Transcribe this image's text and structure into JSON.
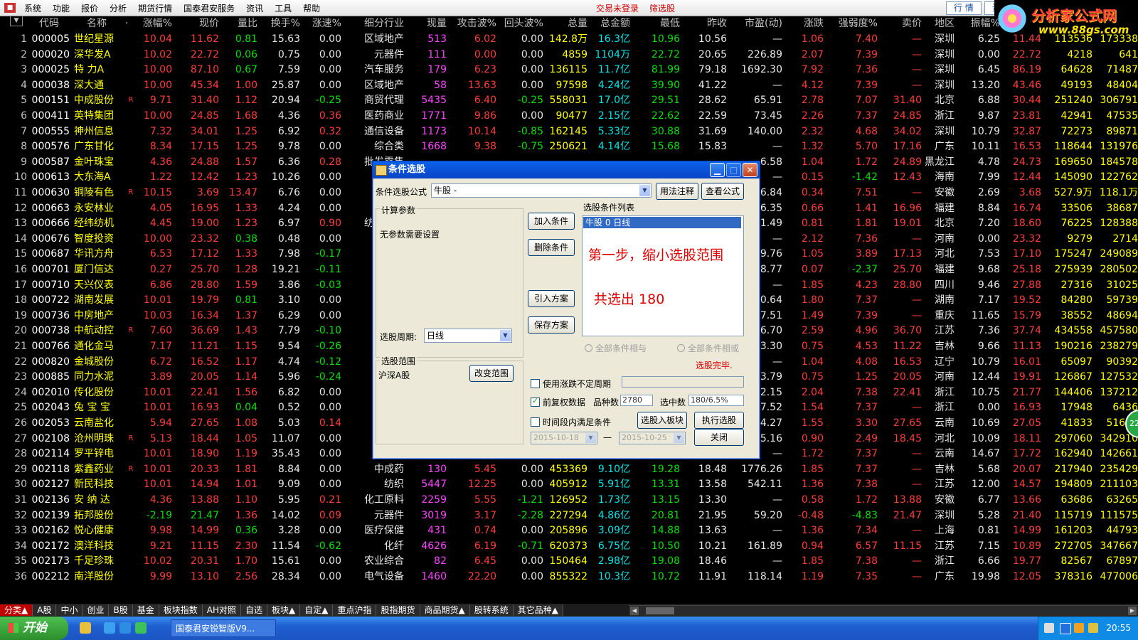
{
  "menu": {
    "items": [
      "系统",
      "功能",
      "报价",
      "分析",
      "期货行情",
      "国泰君安服务",
      "资讯",
      "工具",
      "帮助"
    ],
    "red_items": [
      "交易未登录",
      "筛选股"
    ],
    "right_buttons": [
      "行 情",
      "资"
    ]
  },
  "brand": {
    "title": "分析家公式网",
    "url": "www.88gs.com"
  },
  "header": [
    "代码",
    "名称",
    "·",
    "涨幅%",
    "现价",
    "量比",
    "换手%",
    "涨速%",
    "细分行业",
    "现量",
    "攻击波%",
    "回头波%",
    "总量",
    "总金额",
    "最低",
    "昨收",
    "市盈(动)",
    "涨跌",
    "强弱度%",
    "卖价",
    "地区",
    "振幅%",
    "最高",
    "总量",
    "现价"
  ],
  "rows": [
    [
      "1",
      "000005",
      "世纪星源",
      "",
      "10.04",
      "11.62",
      "0.81",
      "15.63",
      "0.00",
      "区域地产",
      "513",
      "6.02",
      "0.00",
      "142.8万",
      "16.3亿",
      "10.96",
      "10.56",
      "—",
      "1.06",
      "7.40",
      "—",
      "深圳",
      "6.25",
      "11.44",
      "113536",
      "173338"
    ],
    [
      "2",
      "000020",
      "深华发A",
      "",
      "10.02",
      "22.72",
      "0.06",
      "0.75",
      "0.00",
      "元器件",
      "111",
      "0.00",
      "0.00",
      "4859",
      "1104万",
      "22.72",
      "20.65",
      "226.89",
      "2.07",
      "7.39",
      "—",
      "深圳",
      "0.00",
      "22.72",
      "4218",
      "641"
    ],
    [
      "3",
      "000025",
      "特 力A",
      "",
      "10.00",
      "87.10",
      "0.67",
      "7.59",
      "0.00",
      "汽车服务",
      "179",
      "6.23",
      "0.00",
      "136115",
      "11.7亿",
      "81.99",
      "79.18",
      "1692.30",
      "7.92",
      "7.36",
      "—",
      "深圳",
      "6.45",
      "86.19",
      "64628",
      "71487"
    ],
    [
      "4",
      "000038",
      "深大通",
      "",
      "10.00",
      "45.34",
      "1.00",
      "25.87",
      "0.00",
      "区域地产",
      "58",
      "13.63",
      "0.00",
      "97598",
      "4.24亿",
      "39.90",
      "41.22",
      "—",
      "4.12",
      "7.39",
      "—",
      "深圳",
      "13.20",
      "43.46",
      "49193",
      "48404"
    ],
    [
      "5",
      "000151",
      "中成股份",
      "R",
      "9.71",
      "31.40",
      "1.12",
      "20.94",
      "-0.25",
      "商贸代理",
      "5435",
      "6.40",
      "-0.25",
      "558031",
      "17.0亿",
      "29.51",
      "28.62",
      "65.91",
      "2.78",
      "7.07",
      "31.40",
      "北京",
      "6.88",
      "30.44",
      "251240",
      "306791"
    ],
    [
      "6",
      "000411",
      "英特集团",
      "",
      "10.00",
      "24.85",
      "1.68",
      "4.36",
      "0.36",
      "医药商业",
      "1771",
      "9.86",
      "0.00",
      "90477",
      "2.15亿",
      "22.62",
      "22.59",
      "73.45",
      "2.26",
      "7.37",
      "24.85",
      "浙江",
      "9.87",
      "23.81",
      "42941",
      "47535"
    ],
    [
      "7",
      "000555",
      "神州信息",
      "",
      "7.32",
      "34.01",
      "1.25",
      "6.92",
      "0.32",
      "通信设备",
      "1173",
      "10.14",
      "-0.85",
      "162145",
      "5.33亿",
      "30.88",
      "31.69",
      "140.00",
      "2.32",
      "4.68",
      "34.02",
      "深圳",
      "10.79",
      "32.87",
      "72273",
      "89871"
    ],
    [
      "8",
      "000576",
      "广东甘化",
      "",
      "8.34",
      "17.15",
      "1.25",
      "9.78",
      "0.00",
      "综合类",
      "1668",
      "9.38",
      "-0.75",
      "250621",
      "4.14亿",
      "15.68",
      "15.83",
      "—",
      "1.32",
      "5.70",
      "17.16",
      "广东",
      "10.11",
      "16.53",
      "118644",
      "131976"
    ],
    [
      "9",
      "000587",
      "金叶珠宝",
      "",
      "4.36",
      "24.88",
      "1.57",
      "6.36",
      "0.28",
      "批发零售",
      "",
      "",
      "",
      "",
      "",
      "",
      "",
      "6.58",
      "1.04",
      "1.72",
      "24.89",
      "黑龙江",
      "4.78",
      "24.73",
      "169650",
      "184578"
    ],
    [
      "10",
      "000613",
      "大东海A",
      "",
      "1.22",
      "12.42",
      "1.23",
      "10.26",
      "0.00",
      "旅游",
      "",
      "",
      "",
      "",
      "",
      "",
      "",
      "—",
      "0.15",
      "-1.42",
      "12.43",
      "海南",
      "7.99",
      "12.44",
      "145090",
      "122762"
    ],
    [
      "11",
      "000630",
      "铜陵有色",
      "R",
      "10.15",
      "3.69",
      "13.47",
      "6.76",
      "0.00",
      "",
      "",
      "",
      "",
      "",
      "",
      "",
      "",
      "6.84",
      "0.34",
      "7.51",
      "—",
      "安徽",
      "2.69",
      "3.68",
      "527.9万",
      "118.1万"
    ],
    [
      "12",
      "000663",
      "永安林业",
      "",
      "4.05",
      "16.95",
      "1.33",
      "4.24",
      "0.00",
      "",
      "",
      "",
      "",
      "",
      "",
      "",
      "",
      "6.35",
      "0.66",
      "1.41",
      "16.96",
      "福建",
      "8.84",
      "16.74",
      "33506",
      "38687"
    ],
    [
      "13",
      "000666",
      "经纬纺机",
      "",
      "4.45",
      "19.00",
      "1.23",
      "6.97",
      "0.90",
      "纺织机械",
      "",
      "",
      "",
      "",
      "",
      "",
      "",
      "1.49",
      "0.81",
      "1.81",
      "19.01",
      "北京",
      "7.20",
      "18.60",
      "76225",
      "128388"
    ],
    [
      "14",
      "000676",
      "智度投资",
      "",
      "10.00",
      "23.32",
      "0.38",
      "0.48",
      "0.00",
      "",
      "",
      "",
      "",
      "",
      "",
      "",
      "",
      "—",
      "2.12",
      "7.36",
      "—",
      "河南",
      "0.00",
      "23.32",
      "9279",
      "2714"
    ],
    [
      "15",
      "000687",
      "华讯方舟",
      "",
      "6.53",
      "17.12",
      "1.33",
      "7.98",
      "-0.17",
      "",
      "",
      "",
      "",
      "",
      "",
      "",
      "",
      "9.76",
      "1.05",
      "3.89",
      "17.13",
      "河北",
      "7.53",
      "17.10",
      "175247",
      "249089"
    ],
    [
      "16",
      "000701",
      "厦门信达",
      "",
      "0.27",
      "25.70",
      "1.28",
      "19.21",
      "-0.11",
      "",
      "",
      "",
      "",
      "",
      "",
      "",
      "",
      "8.77",
      "0.07",
      "-2.37",
      "25.70",
      "福建",
      "9.68",
      "25.18",
      "275939",
      "280502"
    ],
    [
      "17",
      "000710",
      "天兴仪表",
      "",
      "6.86",
      "28.80",
      "1.59",
      "3.86",
      "-0.03",
      "汽车",
      "",
      "",
      "",
      "",
      "",
      "",
      "",
      "—",
      "1.85",
      "4.23",
      "28.80",
      "四川",
      "9.46",
      "27.88",
      "27316",
      "31025"
    ],
    [
      "18",
      "000722",
      "湖南发展",
      "",
      "10.01",
      "19.79",
      "0.81",
      "3.10",
      "0.00",
      "水力",
      "",
      "",
      "",
      "",
      "",
      "",
      "",
      "0.64",
      "1.80",
      "7.37",
      "—",
      "湖南",
      "7.17",
      "19.52",
      "84280",
      "59739"
    ],
    [
      "19",
      "000736",
      "中房地产",
      "",
      "10.03",
      "16.34",
      "1.37",
      "6.29",
      "0.00",
      "全国",
      "",
      "",
      "",
      "",
      "",
      "",
      "",
      "7.51",
      "1.49",
      "7.39",
      "—",
      "重庆",
      "11.65",
      "15.79",
      "38552",
      "48694"
    ],
    [
      "20",
      "000738",
      "中航动控",
      "R",
      "7.60",
      "36.69",
      "1.43",
      "7.79",
      "-0.10",
      "",
      "",
      "",
      "",
      "",
      "",
      "",
      "",
      "6.70",
      "2.59",
      "4.96",
      "36.70",
      "江苏",
      "7.36",
      "37.74",
      "434558",
      "457580"
    ],
    [
      "21",
      "000766",
      "通化金马",
      "",
      "7.17",
      "11.21",
      "1.15",
      "9.54",
      "-0.26",
      "",
      "",
      "",
      "",
      "",
      "",
      "",
      "",
      "3.30",
      "0.75",
      "4.53",
      "11.22",
      "吉林",
      "9.66",
      "11.13",
      "190216",
      "238279"
    ],
    [
      "22",
      "000820",
      "金城股份",
      "",
      "6.72",
      "16.52",
      "1.17",
      "4.74",
      "-0.12",
      "",
      "",
      "",
      "",
      "",
      "",
      "",
      "",
      "—",
      "1.04",
      "4.08",
      "16.53",
      "辽宁",
      "10.79",
      "16.01",
      "65097",
      "90392"
    ],
    [
      "23",
      "000885",
      "同力水泥",
      "",
      "3.89",
      "20.05",
      "1.14",
      "5.96",
      "-0.24",
      "",
      "",
      "",
      "",
      "",
      "",
      "",
      "",
      "3.79",
      "0.75",
      "1.25",
      "20.05",
      "河南",
      "12.44",
      "19.91",
      "126867",
      "127532"
    ],
    [
      "24",
      "002010",
      "传化股份",
      "",
      "10.01",
      "22.41",
      "1.56",
      "6.82",
      "0.00",
      "染料",
      "",
      "",
      "",
      "",
      "",
      "",
      "",
      "2.15",
      "2.04",
      "7.38",
      "22.41",
      "浙江",
      "10.75",
      "21.77",
      "144406",
      "137212"
    ],
    [
      "25",
      "002043",
      "兔 宝 宝",
      "",
      "10.01",
      "16.93",
      "0.04",
      "0.52",
      "0.00",
      "其他",
      "",
      "",
      "",
      "",
      "",
      "",
      "",
      "7.52",
      "1.54",
      "7.37",
      "—",
      "浙江",
      "0.00",
      "16.93",
      "17948",
      "6436"
    ],
    [
      "26",
      "002053",
      "云南盐化",
      "",
      "5.94",
      "27.65",
      "1.08",
      "5.03",
      "0.14",
      "化工",
      "",
      "",
      "",
      "",
      "",
      "",
      "",
      "4.27",
      "1.55",
      "3.30",
      "27.65",
      "云南",
      "10.69",
      "27.05",
      "41833",
      "51627"
    ],
    [
      "27",
      "002108",
      "沧州明珠",
      "R",
      "5.13",
      "18.44",
      "1.05",
      "11.07",
      "0.00",
      "",
      "",
      "",
      "",
      "",
      "",
      "",
      "",
      "5.16",
      "0.90",
      "2.49",
      "18.45",
      "河北",
      "10.09",
      "18.11",
      "297060",
      "342910"
    ],
    [
      "28",
      "002114",
      "罗平锌电",
      "",
      "10.01",
      "18.90",
      "1.19",
      "35.43",
      "0.00",
      "铅锌",
      "365",
      "15.38",
      "0.00",
      "305602",
      "5.42亿",
      "16.38",
      "17.18",
      "—",
      "1.72",
      "7.37",
      "—",
      "云南",
      "14.67",
      "17.72",
      "162940",
      "142661"
    ],
    [
      "29",
      "002118",
      "紫鑫药业",
      "R",
      "10.01",
      "20.33",
      "1.81",
      "8.84",
      "0.00",
      "中成药",
      "130",
      "5.45",
      "0.00",
      "453369",
      "9.10亿",
      "19.28",
      "18.48",
      "1776.26",
      "1.85",
      "7.37",
      "—",
      "吉林",
      "5.68",
      "20.07",
      "217940",
      "235429"
    ],
    [
      "30",
      "002127",
      "新民科技",
      "",
      "10.01",
      "14.94",
      "1.01",
      "9.09",
      "0.00",
      "纺织",
      "5447",
      "12.25",
      "0.00",
      "405912",
      "5.91亿",
      "13.31",
      "13.58",
      "542.11",
      "1.36",
      "7.38",
      "—",
      "江苏",
      "12.00",
      "14.57",
      "194809",
      "211103"
    ],
    [
      "31",
      "002136",
      "安 纳 达",
      "",
      "4.36",
      "13.88",
      "1.10",
      "5.95",
      "0.21",
      "化工原料",
      "2259",
      "5.55",
      "-1.21",
      "126952",
      "1.73亿",
      "13.15",
      "13.30",
      "—",
      "0.58",
      "1.72",
      "13.88",
      "安徽",
      "6.77",
      "13.66",
      "63686",
      "63265"
    ],
    [
      "32",
      "002139",
      "拓邦股份",
      "",
      "-2.19",
      "21.47",
      "1.36",
      "14.02",
      "0.09",
      "元器件",
      "3019",
      "3.17",
      "-2.28",
      "227294",
      "4.86亿",
      "20.81",
      "21.95",
      "59.20",
      "-0.48",
      "-4.83",
      "21.47",
      "深圳",
      "5.28",
      "21.40",
      "115719",
      "111575"
    ],
    [
      "33",
      "002162",
      "悦心健康",
      "",
      "9.98",
      "14.99",
      "0.36",
      "3.28",
      "0.00",
      "医疗保健",
      "431",
      "0.74",
      "0.00",
      "205896",
      "3.09亿",
      "14.88",
      "13.63",
      "—",
      "1.36",
      "7.34",
      "—",
      "上海",
      "0.81",
      "14.99",
      "161203",
      "44793"
    ],
    [
      "34",
      "002172",
      "澳洋科技",
      "",
      "9.21",
      "11.15",
      "2.30",
      "11.54",
      "-0.62",
      "化纤",
      "4626",
      "6.19",
      "-0.71",
      "620373",
      "6.75亿",
      "10.50",
      "10.21",
      "161.89",
      "0.94",
      "6.57",
      "11.15",
      "江苏",
      "7.15",
      "10.89",
      "272705",
      "347667"
    ],
    [
      "35",
      "002173",
      "千足珍珠",
      "",
      "10.02",
      "20.31",
      "1.70",
      "15.61",
      "0.00",
      "农业综合",
      "82",
      "6.45",
      "0.00",
      "150464",
      "2.98亿",
      "19.08",
      "18.46",
      "—",
      "1.85",
      "7.38",
      "—",
      "浙江",
      "6.66",
      "19.77",
      "82567",
      "67897"
    ],
    [
      "36",
      "002212",
      "南洋股份",
      "",
      "9.99",
      "13.10",
      "2.56",
      "28.34",
      "0.00",
      "电气设备",
      "1460",
      "22.20",
      "0.00",
      "855322",
      "10.3亿",
      "10.72",
      "11.91",
      "118.14",
      "1.19",
      "7.35",
      "—",
      "广东",
      "19.98",
      "12.05",
      "378316",
      "477006"
    ]
  ],
  "tabs": [
    "分类▲",
    "A股",
    "中小",
    "创业",
    "B股",
    "基金",
    "板块指数",
    "AH对照",
    "自选",
    "板块▲",
    "自定▲",
    "重点沪指",
    "股指期货",
    "商品期货▲",
    "股转系统",
    "其它品种▲"
  ],
  "dialog": {
    "title": "条件选股",
    "formula_label": "条件选股公式",
    "formula_value": "牛股      -",
    "btn_usage": "用法注释",
    "btn_view": "查看公式",
    "calc_params": "计算参数",
    "no_params": "无参数需要设置",
    "list_title": "选股条件列表",
    "list_item": "牛股  0  日线",
    "note_step": "第一步，缩小选股范围",
    "note_count": "共选出    180",
    "btn_add": "加入条件",
    "btn_delete": "删除条件",
    "btn_import": "引入方案",
    "btn_save": "保存方案",
    "period_label": "选股周期:",
    "period_value": "日线",
    "radio_and": "全部条件相与",
    "radio_or": "全部条件相或",
    "range_title": "选股范围",
    "range_value": "沪深A股",
    "btn_change_range": "改变范围",
    "done": "选股完毕.",
    "chk_period": "使用涨跌不定周期",
    "chk_adjust": "前复权数据",
    "varieties_label": "品种数",
    "varieties_value": "2780",
    "selected_label": "选中数",
    "selected_value": "180/6.5%",
    "chk_time": "时间段内满足条件",
    "btn_to_block": "选股入板块",
    "btn_execute": "执行选股",
    "date_from": "2015-10-18",
    "date_sep": "—",
    "date_to": "2015-10-25",
    "btn_close": "关闭"
  },
  "taskbar": {
    "start": "开始",
    "task_item": "国泰君安锐智版V9...",
    "clock": "20:55",
    "side_badge": "22"
  },
  "colors": {
    "up": "#ff3c3c",
    "down": "#00e000",
    "name": "#ffff00",
    "dialog_bg": "#ece9d8",
    "title_bar": "#0a4fd6"
  }
}
